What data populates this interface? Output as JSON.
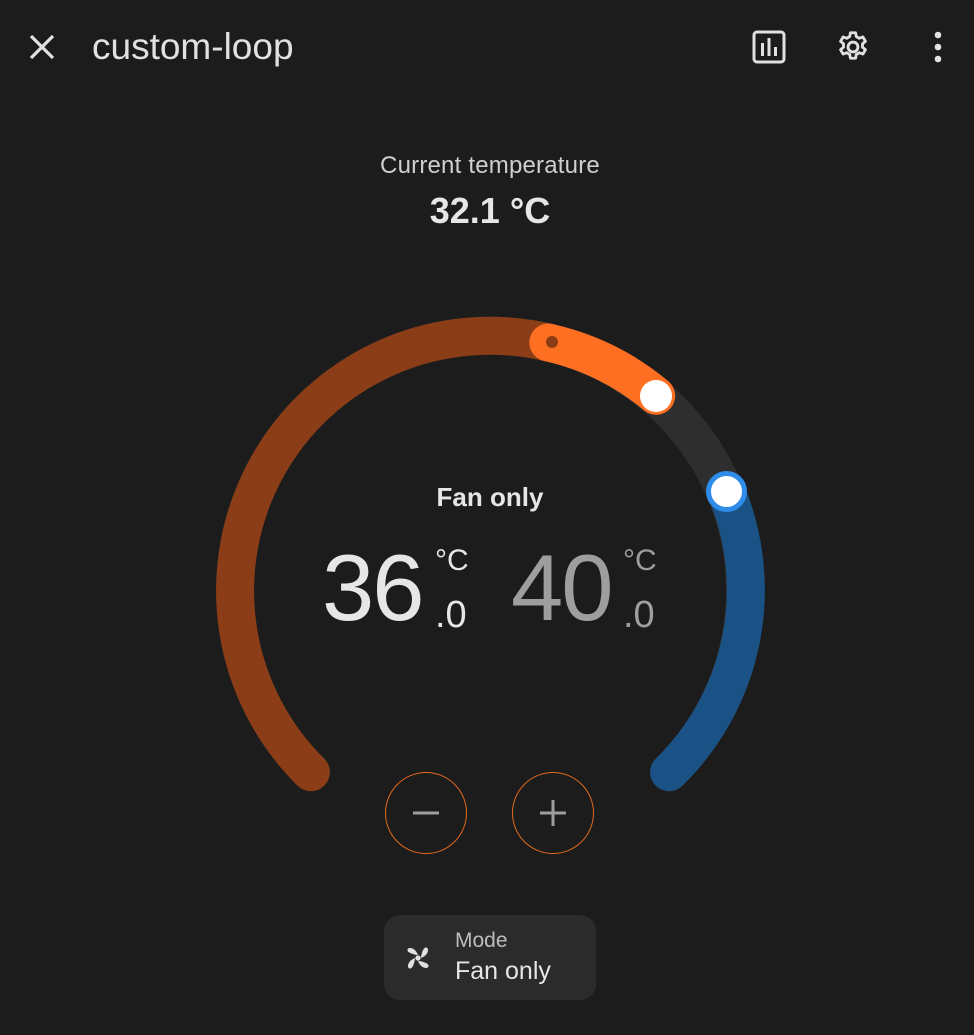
{
  "header": {
    "title": "custom-loop",
    "close_icon": "close-icon",
    "history_icon": "history-chart-icon",
    "settings_icon": "gear-icon",
    "more_icon": "more-vertical-icon"
  },
  "current": {
    "label": "Current temperature",
    "value": "32.1 °C"
  },
  "dial": {
    "mode_label": "Fan only",
    "low": {
      "integer": "36",
      "unit": "°C",
      "decimal": ".0"
    },
    "high": {
      "integer": "40",
      "unit": "°C",
      "decimal": ".0"
    },
    "colors": {
      "heat_track": "#8a3d17",
      "heat_active": "#ff6f22",
      "cool_track": "#1a5285",
      "neutral_track": "#2e2e2e",
      "cool_handle_ring": "#2f8ce9",
      "handle": "#ffffff"
    }
  },
  "controls": {
    "minus_icon": "minus-icon",
    "plus_icon": "plus-icon",
    "accent": "#e0691f"
  },
  "mode": {
    "label": "Mode",
    "value": "Fan only",
    "icon": "fan-icon"
  }
}
